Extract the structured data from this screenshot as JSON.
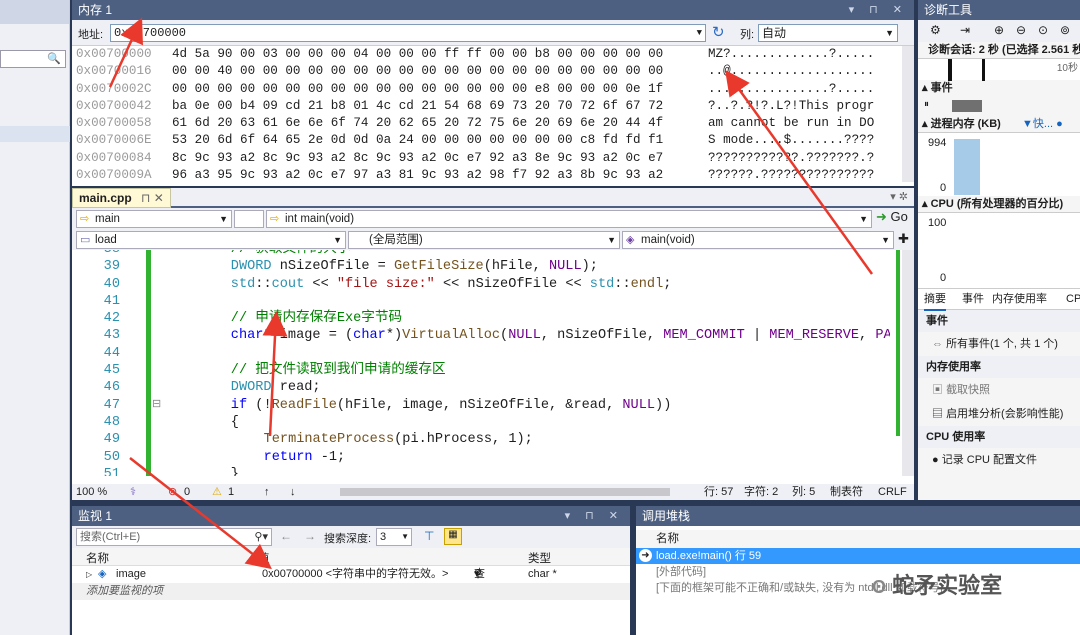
{
  "memory": {
    "title": "内存 1",
    "address_label": "地址:",
    "address_value": "0x00700000",
    "columns_label": "列:",
    "columns_value": "自动",
    "rows": [
      {
        "addr": "0x00700000",
        "hex": "4d 5a 90 00 03 00 00 00 04 00 00 00 ff ff 00 00 b8 00 00 00 00 00",
        "ascii": "MZ?.............?....."
      },
      {
        "addr": "0x00700016",
        "hex": "00 00 40 00 00 00 00 00 00 00 00 00 00 00 00 00 00 00 00 00 00 00",
        "ascii": "..@..................."
      },
      {
        "addr": "0x0070002C",
        "hex": "00 00 00 00 00 00 00 00 00 00 00 00 00 00 00 00 e8 00 00 00 0e 1f",
        "ascii": "................?....."
      },
      {
        "addr": "0x00700042",
        "hex": "ba 0e 00 b4 09 cd 21 b8 01 4c cd 21 54 68 69 73 20 70 72 6f 67 72",
        "ascii": "?..?.?!?.L?!This progr"
      },
      {
        "addr": "0x00700058",
        "hex": "61 6d 20 63 61 6e 6e 6f 74 20 62 65 20 72 75 6e 20 69 6e 20 44 4f",
        "ascii": "am cannot be run in DO"
      },
      {
        "addr": "0x0070006E",
        "hex": "53 20 6d 6f 64 65 2e 0d 0d 0a 24 00 00 00 00 00 00 00 c8 fd fd f1",
        "ascii": "S mode....$.......????"
      },
      {
        "addr": "0x00700084",
        "hex": "8c 9c 93 a2 8c 9c 93 a2 8c 9c 93 a2 0c e7 92 a3 8e 9c 93 a2 0c e7",
        "ascii": "????????????.???????.?"
      },
      {
        "addr": "0x0070009A",
        "hex": "96 a3 95 9c 93 a2 0c e7 97 a3 81 9c 93 a2 98 f7 92 a3 8b 9c 93 a2",
        "ascii": "??????.???????????????"
      }
    ]
  },
  "editor": {
    "tab_label": "main.cpp",
    "nav": {
      "project": "main",
      "function": "int main(void)",
      "go_label": "Go",
      "file": "load",
      "scope": "(全局范围)",
      "member": "main(void)"
    },
    "lines": [
      {
        "n": "38",
        "indent": 4,
        "tokens": [
          {
            "c": "cmt",
            "t": "// 获取文件的大小"
          }
        ]
      },
      {
        "n": "39",
        "indent": 4,
        "tokens": [
          {
            "c": "ty",
            "t": "DWORD"
          },
          {
            "c": "txt",
            "t": " nSizeOfFile = "
          },
          {
            "c": "fn",
            "t": "GetFileSize"
          },
          {
            "c": "txt",
            "t": "(hFile, "
          },
          {
            "c": "mac",
            "t": "NULL"
          },
          {
            "c": "txt",
            "t": ");"
          }
        ]
      },
      {
        "n": "40",
        "indent": 4,
        "tokens": [
          {
            "c": "ty",
            "t": "std"
          },
          {
            "c": "txt",
            "t": "::"
          },
          {
            "c": "ty",
            "t": "cout"
          },
          {
            "c": "txt",
            "t": " << "
          },
          {
            "c": "str",
            "t": "\"file size:\""
          },
          {
            "c": "txt",
            "t": " << nSizeOfFile << "
          },
          {
            "c": "ty",
            "t": "std"
          },
          {
            "c": "txt",
            "t": "::"
          },
          {
            "c": "fn",
            "t": "endl"
          },
          {
            "c": "txt",
            "t": ";"
          }
        ]
      },
      {
        "n": "41",
        "indent": 0,
        "tokens": []
      },
      {
        "n": "42",
        "indent": 4,
        "tokens": [
          {
            "c": "cmt",
            "t": "// 申请内存保存Exe字节码"
          }
        ]
      },
      {
        "n": "43",
        "indent": 4,
        "tokens": [
          {
            "c": "kw",
            "t": "char"
          },
          {
            "c": "txt",
            "t": "* image = ("
          },
          {
            "c": "kw",
            "t": "char"
          },
          {
            "c": "txt",
            "t": "*)"
          },
          {
            "c": "fn",
            "t": "VirtualAlloc"
          },
          {
            "c": "txt",
            "t": "("
          },
          {
            "c": "mac",
            "t": "NULL"
          },
          {
            "c": "txt",
            "t": ", nSizeOfFile, "
          },
          {
            "c": "mac",
            "t": "MEM_COMMIT"
          },
          {
            "c": "txt",
            "t": " | "
          },
          {
            "c": "mac",
            "t": "MEM_RESERVE"
          },
          {
            "c": "txt",
            "t": ", "
          },
          {
            "c": "mac",
            "t": "PAGE_REA"
          }
        ]
      },
      {
        "n": "44",
        "indent": 0,
        "tokens": []
      },
      {
        "n": "45",
        "indent": 4,
        "tokens": [
          {
            "c": "cmt",
            "t": "// 把文件读取到我们申请的缓存区"
          }
        ]
      },
      {
        "n": "46",
        "indent": 4,
        "tokens": [
          {
            "c": "ty",
            "t": "DWORD"
          },
          {
            "c": "txt",
            "t": " read;"
          }
        ]
      },
      {
        "n": "47",
        "indent": 4,
        "tokens": [
          {
            "c": "kw",
            "t": "if"
          },
          {
            "c": "txt",
            "t": " (!"
          },
          {
            "c": "fn",
            "t": "ReadFile"
          },
          {
            "c": "txt",
            "t": "(hFile, image, nSizeOfFile, &read, "
          },
          {
            "c": "mac",
            "t": "NULL"
          },
          {
            "c": "txt",
            "t": "))"
          }
        ]
      },
      {
        "n": "48",
        "indent": 4,
        "tokens": [
          {
            "c": "txt",
            "t": "{"
          }
        ]
      },
      {
        "n": "49",
        "indent": 8,
        "tokens": [
          {
            "c": "fn",
            "t": "TerminateProcess"
          },
          {
            "c": "txt",
            "t": "(pi.hProcess, 1);"
          }
        ]
      },
      {
        "n": "50",
        "indent": 8,
        "tokens": [
          {
            "c": "kw",
            "t": "return"
          },
          {
            "c": "txt",
            "t": " -1;"
          }
        ]
      },
      {
        "n": "51",
        "indent": 4,
        "tokens": [
          {
            "c": "txt",
            "t": "}"
          }
        ]
      }
    ],
    "status": {
      "zoom": "100 %",
      "errors": "0",
      "warnings": "1",
      "line": "行: 57",
      "char": "字符: 2",
      "col": "列: 5",
      "tabs": "制表符",
      "eol": "CRLF"
    }
  },
  "diagnostics": {
    "title": "诊断工具",
    "session": "诊断会话: 2 秒 (已选择 2.561 秒)",
    "timeline_label": "10秒",
    "events_label": "▴ 事件",
    "memory_label": "▴ 进程内存 (KB)",
    "memory_legend": "▼快...  ● ",
    "memory_max": "994",
    "memory_min": "0",
    "cpu_label": "▴ CPU (所有处理器的百分比)",
    "cpu_max": "100",
    "cpu_min": "0",
    "tabs": [
      "摘要",
      "事件",
      "内存使用率",
      "CPU"
    ],
    "events_header": "事件",
    "events_item": "所有事件(1 个, 共 1 个)",
    "mem_header": "内存使用率",
    "mem_items": [
      "截取快照",
      "启用堆分析(会影响性能)"
    ],
    "cpu_header": "CPU 使用率",
    "cpu_item": "记录 CPU 配置文件"
  },
  "watch": {
    "title": "监视 1",
    "search_placeholder": "搜索(Ctrl+E)",
    "depth_label": "搜索深度:",
    "depth_value": "3",
    "col_name": "名称",
    "col_value": "值",
    "col_type": "类型",
    "rows": [
      {
        "name": "image",
        "value": "0x00700000 <字符串中的字符无效。>",
        "view": "查看",
        "type": "char *"
      }
    ],
    "add_item": "添加要监视的项"
  },
  "callstack": {
    "title": "调用堆栈",
    "col_name": "名称",
    "rows": [
      "load.exe!main() 行 59",
      "[外部代码]",
      "[下面的框架可能不正确和/或缺失, 没有为 ntdll.dll 加载符号]"
    ]
  },
  "watermark": "蛇矛实验室",
  "colors": {
    "arrow": "#e8392c",
    "panel_header": "#4d6082",
    "selection": "#3399ff"
  }
}
